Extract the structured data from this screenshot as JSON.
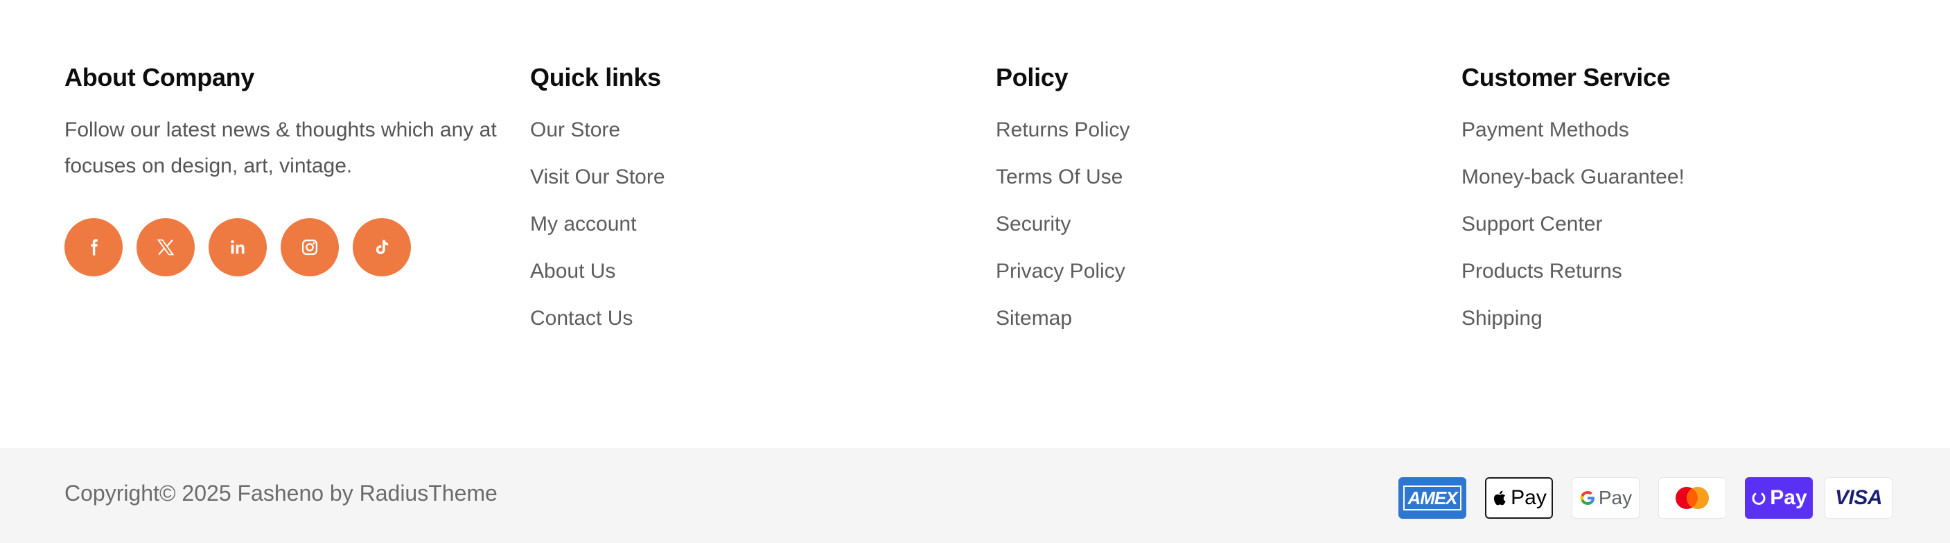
{
  "about": {
    "heading": "About Company",
    "text": "Follow our latest news & thoughts which any at focuses on design, art, vintage.",
    "socials": [
      {
        "icon": "facebook-icon"
      },
      {
        "icon": "x-twitter-icon"
      },
      {
        "icon": "linkedin-icon"
      },
      {
        "icon": "instagram-icon"
      },
      {
        "icon": "tiktok-icon"
      }
    ]
  },
  "quick_links": {
    "heading": "Quick links",
    "items": [
      "Our Store",
      "Visit Our Store",
      "My account",
      "About Us",
      "Contact Us"
    ]
  },
  "policy": {
    "heading": "Policy",
    "items": [
      "Returns Policy",
      "Terms Of Use",
      "Security",
      "Privacy Policy",
      "Sitemap"
    ]
  },
  "customer_service": {
    "heading": "Customer Service",
    "items": [
      "Payment Methods",
      "Money-back Guarantee!",
      "Support Center",
      "Products Returns",
      "Shipping"
    ]
  },
  "copyright": "Copyright© 2025 Fasheno by RadiusTheme",
  "payments": {
    "amex": "AMEX",
    "applepay": "Pay",
    "googlepay": "Pay",
    "shoppay": "Pay",
    "visa": "VISA"
  },
  "colors": {
    "accent": "#ee7a41",
    "bottom_bar": "#f5f5f5",
    "amex_blue": "#2e77d0",
    "shop_pay_purple": "#5a31f4",
    "visa_blue": "#1a1f71"
  }
}
